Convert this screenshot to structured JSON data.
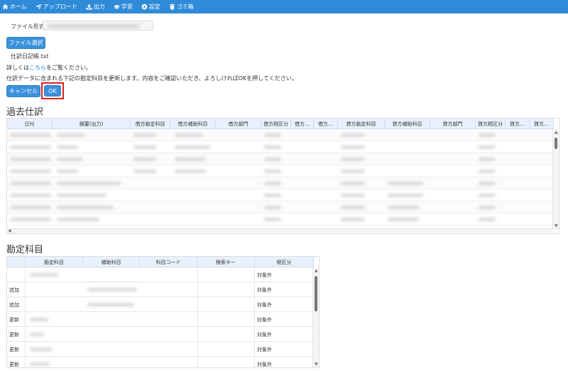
{
  "nav": {
    "items": [
      {
        "label": "ホーム",
        "icon": "home-icon"
      },
      {
        "label": "アップロード",
        "icon": "upload-icon"
      },
      {
        "label": "出力",
        "icon": "download-icon"
      },
      {
        "label": "学習",
        "icon": "graduation-cap-icon"
      },
      {
        "label": "設定",
        "icon": "gear-icon"
      },
      {
        "label": "ゴミ箱",
        "icon": "trash-icon"
      }
    ],
    "background": "#2f8bd8"
  },
  "form": {
    "filetype_label": "ファイル形式",
    "file_button": "ファイル選択",
    "filename": "仕訳日記帳.txt",
    "info_prefix": "詳しくは",
    "info_link": "こちら",
    "info_suffix": "をご覧ください。",
    "info2": "仕訳データに含まれる下記の勘定科目を更新します。内容をご確認いただき、よろしければOKを押してください。",
    "cancel_button": "キャンセル",
    "ok_button": "OK",
    "highlight_color": "#e0201b"
  },
  "journal": {
    "title": "過去仕訳",
    "columns": [
      "日付",
      "摘要(出力)",
      "借方勘定科目",
      "借方補助科目",
      "借方部門",
      "借方税区分",
      "借方…",
      "借方…",
      "貸方勘定科目",
      "貸方補助科目",
      "貸方部門",
      "貸方税区分",
      "貸方…",
      "貸方…"
    ]
  },
  "accounts": {
    "title": "勘定科目",
    "columns": [
      "",
      "勘定科目",
      "補助科目",
      "科目コード",
      "検索キー",
      "税区分"
    ],
    "rows": [
      {
        "action": "",
        "tax": "対象外"
      },
      {
        "action": "追加",
        "tax": "対象外"
      },
      {
        "action": "追加",
        "tax": "対象外"
      },
      {
        "action": "更新",
        "tax": "対象外"
      },
      {
        "action": "更新",
        "tax": "対象外"
      },
      {
        "action": "更新",
        "tax": "対象外"
      },
      {
        "action": "更新",
        "tax": "対象外"
      }
    ]
  }
}
